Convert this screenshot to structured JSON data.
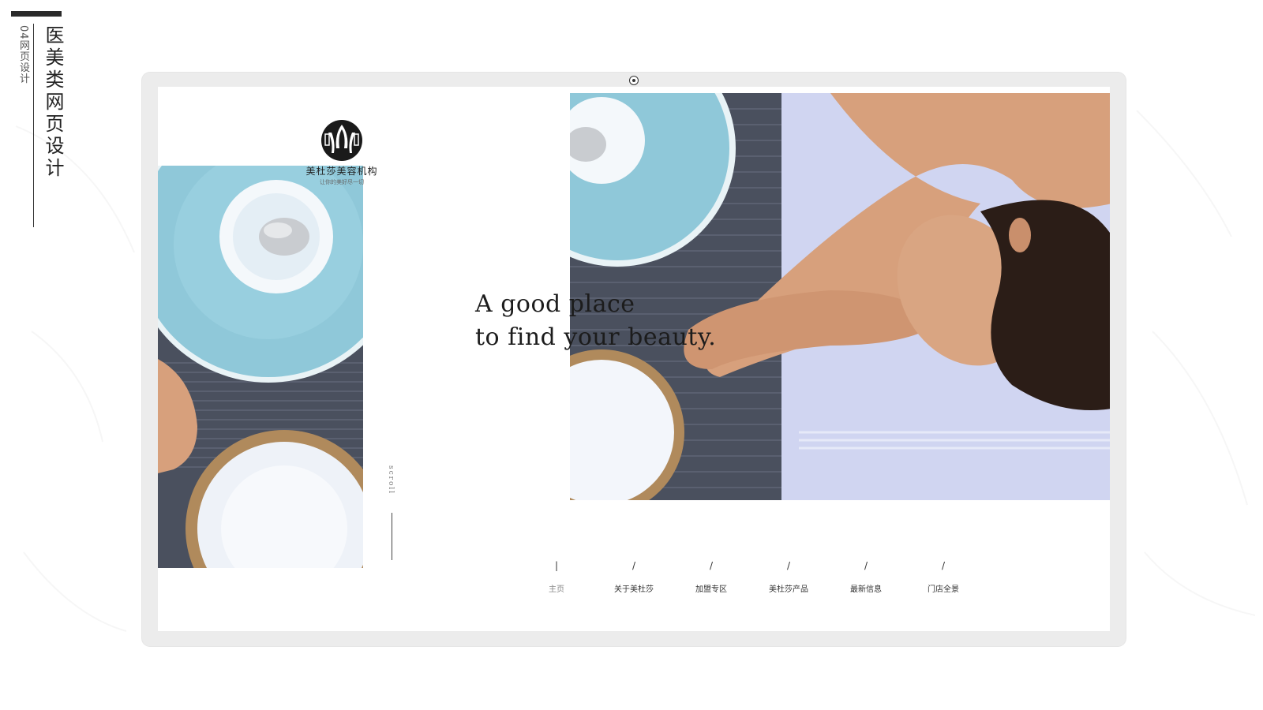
{
  "caption": {
    "small": "04网页设计",
    "big": "医美类网页设计"
  },
  "logo": {
    "name": "美杜莎美容机构",
    "tagline": "让你的美好尽一切"
  },
  "headline": {
    "line1": "A good place",
    "line2": "to find your beauty."
  },
  "scroll_label": "scroll",
  "nav": {
    "items": [
      {
        "label": "主页",
        "mark": "|"
      },
      {
        "label": "关于美杜莎",
        "mark": "/"
      },
      {
        "label": "加盟专区",
        "mark": "/"
      },
      {
        "label": "美杜莎产品",
        "mark": "/"
      },
      {
        "label": "最新信息",
        "mark": "/"
      },
      {
        "label": "门店全景",
        "mark": "/"
      }
    ]
  },
  "colors": {
    "plate_blue": "#8fc8d9",
    "mat_dark": "#4a505e",
    "towel": "#d8dcf2",
    "skin": "#d7a07c",
    "hair": "#2b1d17"
  }
}
